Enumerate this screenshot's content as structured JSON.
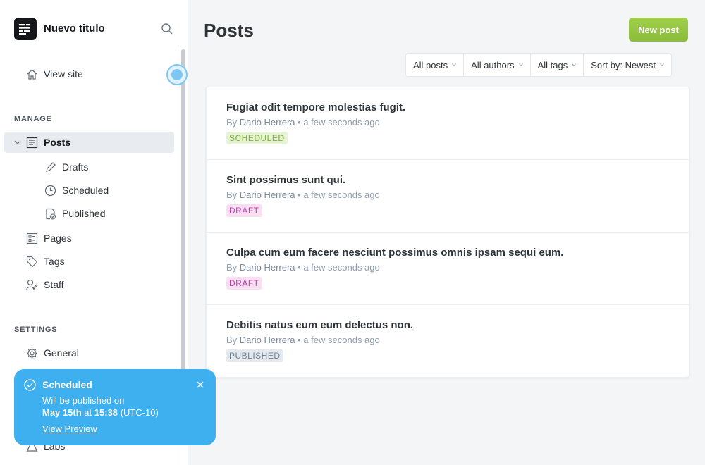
{
  "brand": {
    "title": "Nuevo titulo"
  },
  "sidebar": {
    "view_site": "View site",
    "manage_heading": "MANAGE",
    "posts": "Posts",
    "drafts": "Drafts",
    "scheduled": "Scheduled",
    "published": "Published",
    "pages": "Pages",
    "tags": "Tags",
    "staff": "Staff",
    "settings_heading": "SETTINGS",
    "general": "General",
    "labs": "Labs"
  },
  "main": {
    "title": "Posts",
    "new_post_label": "New post",
    "filters": [
      "All posts",
      "All authors",
      "All tags",
      "Sort by: Newest"
    ]
  },
  "posts": [
    {
      "title": "Fugiat odit tempore molestias fugit.",
      "by": "By",
      "author": "Dario Herrera",
      "time": "• a few seconds ago",
      "status": "SCHEDULED"
    },
    {
      "title": "Sint possimus sunt qui.",
      "by": "By",
      "author": "Dario Herrera",
      "time": "• a few seconds ago",
      "status": "DRAFT"
    },
    {
      "title": "Culpa cum eum facere nesciunt possimus omnis ipsam sequi eum.",
      "by": "By",
      "author": "Dario Herrera",
      "time": "• a few seconds ago",
      "status": "DRAFT"
    },
    {
      "title": "Debitis natus eum eum delectus non.",
      "by": "By",
      "author": "Dario Herrera",
      "time": "• a few seconds ago",
      "status": "PUBLISHED"
    }
  ],
  "toast": {
    "title": "Scheduled",
    "line1": "Will be published on",
    "date": "May 15th",
    "at": "at",
    "time": "15:38",
    "tz": "(UTC-10)",
    "link": "View Preview"
  },
  "colors": {
    "accent_green": "#9fcd4b",
    "toast_blue": "#3eb0ef",
    "scheduled_bg": "#e7f3d6",
    "scheduled_fg": "#7eb02c",
    "draft_bg": "#f8e0f2",
    "draft_fg": "#c53cb0",
    "published_bg": "#e3e9ef",
    "published_fg": "#6f7e8d"
  }
}
